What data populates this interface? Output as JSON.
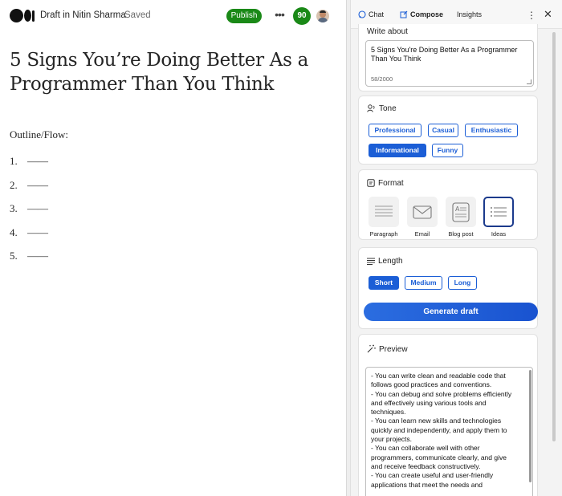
{
  "editor": {
    "draft_label": "Draft in Nitin Sharma",
    "saved_label": "Saved",
    "publish_label": "Publish",
    "more_label": "•••",
    "score": "90",
    "title": "5 Signs You’re Doing Better As a Programmer Than You Think",
    "outline_label": "Outline/Flow:",
    "outline_items": [
      {
        "num": "1.",
        "text": "——"
      },
      {
        "num": "2.",
        "text": "——"
      },
      {
        "num": "3.",
        "text": "——"
      },
      {
        "num": "4.",
        "text": "——"
      },
      {
        "num": "5.",
        "text": "——"
      }
    ]
  },
  "panel": {
    "tabs": [
      {
        "label": "Chat",
        "icon": "chat-icon"
      },
      {
        "label": "Compose",
        "icon": "compose-icon",
        "active": true
      },
      {
        "label": "Insights"
      }
    ],
    "more": "⋮",
    "close": "✕",
    "write_about": {
      "title": "Write about",
      "value": "5 Signs You're Doing Better As a Programmer Than You Think",
      "count": "58/2000"
    },
    "tone": {
      "title": "Tone",
      "options": [
        "Professional",
        "Casual",
        "Enthusiastic",
        "Informational",
        "Funny"
      ],
      "selected": "Informational"
    },
    "format": {
      "title": "Format",
      "options": [
        "Paragraph",
        "Email",
        "Blog post",
        "Ideas"
      ],
      "selected": "Ideas"
    },
    "length": {
      "title": "Length",
      "options": [
        "Short",
        "Medium",
        "Long"
      ],
      "selected": "Short"
    },
    "generate_label": "Generate draft",
    "preview": {
      "title": "Preview",
      "lines": [
        "- You can write clean and readable code that",
        "follows good practices and conventions.",
        "- You can debug and solve problems efficiently",
        "and effectively using various tools and",
        "techniques.",
        "- You can learn new skills and technologies",
        "quickly and independently, and apply them to",
        "your projects.",
        "- You can collaborate well with other",
        "programmers, communicate clearly, and give",
        "and receive feedback constructively.",
        "- You can create useful and user-friendly",
        "applications that meet the needs and"
      ]
    }
  },
  "colors": {
    "accent": "#1b5ed6",
    "publish": "#1a8917"
  }
}
